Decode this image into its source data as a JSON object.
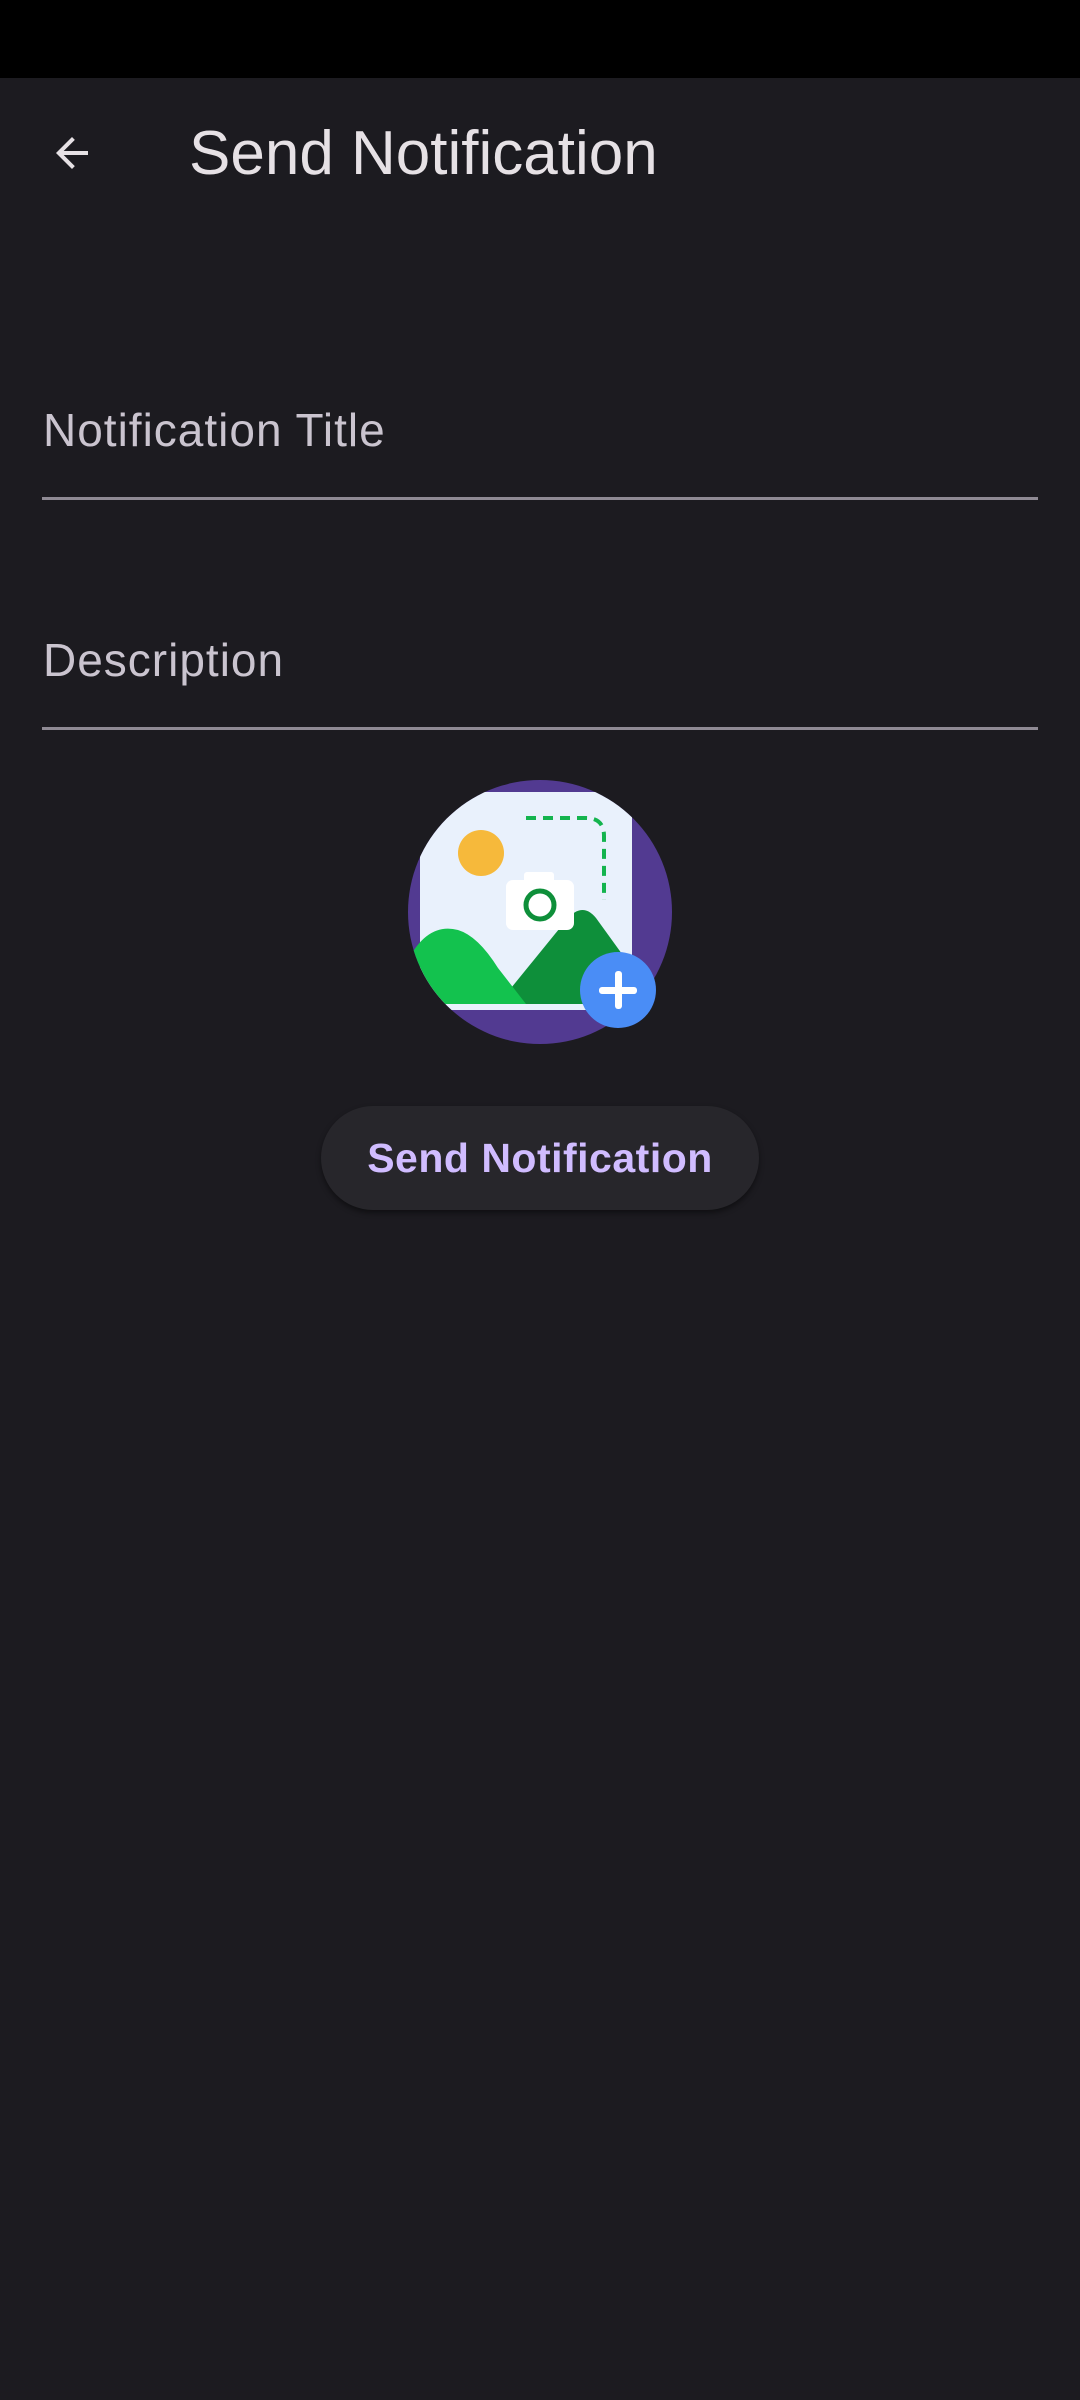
{
  "app_bar": {
    "title": "Send Notification",
    "back_icon": "arrow-back-icon"
  },
  "form": {
    "title_field": {
      "placeholder": "Notification Title",
      "value": ""
    },
    "description_field": {
      "placeholder": "Description",
      "value": ""
    },
    "image_picker_icon": "add-image-icon"
  },
  "actions": {
    "send_label": "Send Notification"
  },
  "colors": {
    "background": "#1c1b20",
    "accent_text": "#d0bcff",
    "image_circle": "#523a91",
    "plus_badge": "#4a8df6"
  }
}
